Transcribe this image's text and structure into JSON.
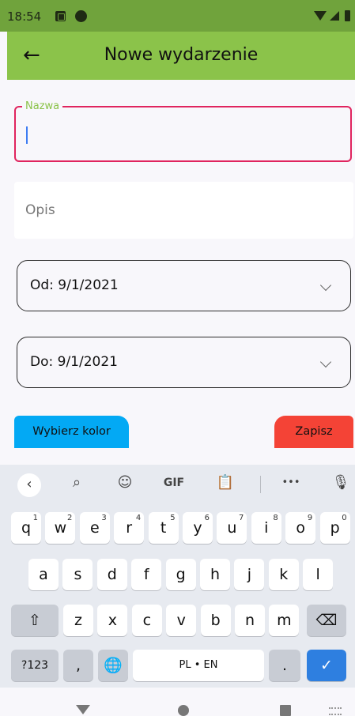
{
  "status_bar": {
    "time": "18:54"
  },
  "app_bar": {
    "title": "Nowe wydarzenie",
    "back_icon": "arrow-back-icon",
    "color": "#8bc34a"
  },
  "form": {
    "name_label": "Nazwa",
    "name_value": "",
    "description_placeholder": "Opis",
    "date_from": "Od: 9/1/2021",
    "date_to": "Do: 9/1/2021"
  },
  "actions": {
    "choose_color_label": "Wybierz kolor",
    "choose_color_bg": "#03a9f4",
    "save_label": "Zapisz",
    "save_bg": "#f44336"
  },
  "keyboard": {
    "toolbar": {
      "gif_label": "GIF",
      "more_label": "•••"
    },
    "row1": [
      {
        "k": "q",
        "s": "1"
      },
      {
        "k": "w",
        "s": "2"
      },
      {
        "k": "e",
        "s": "3"
      },
      {
        "k": "r",
        "s": "4"
      },
      {
        "k": "t",
        "s": "5"
      },
      {
        "k": "y",
        "s": "6"
      },
      {
        "k": "u",
        "s": "7"
      },
      {
        "k": "i",
        "s": "8"
      },
      {
        "k": "o",
        "s": "9"
      },
      {
        "k": "p",
        "s": "0"
      }
    ],
    "row2": [
      "a",
      "s",
      "d",
      "f",
      "g",
      "h",
      "j",
      "k",
      "l"
    ],
    "row3": [
      "z",
      "x",
      "c",
      "v",
      "b",
      "n",
      "m"
    ],
    "symbols_label": "?123",
    "comma_label": ",",
    "space_label": "PL • EN",
    "period_label": "."
  }
}
